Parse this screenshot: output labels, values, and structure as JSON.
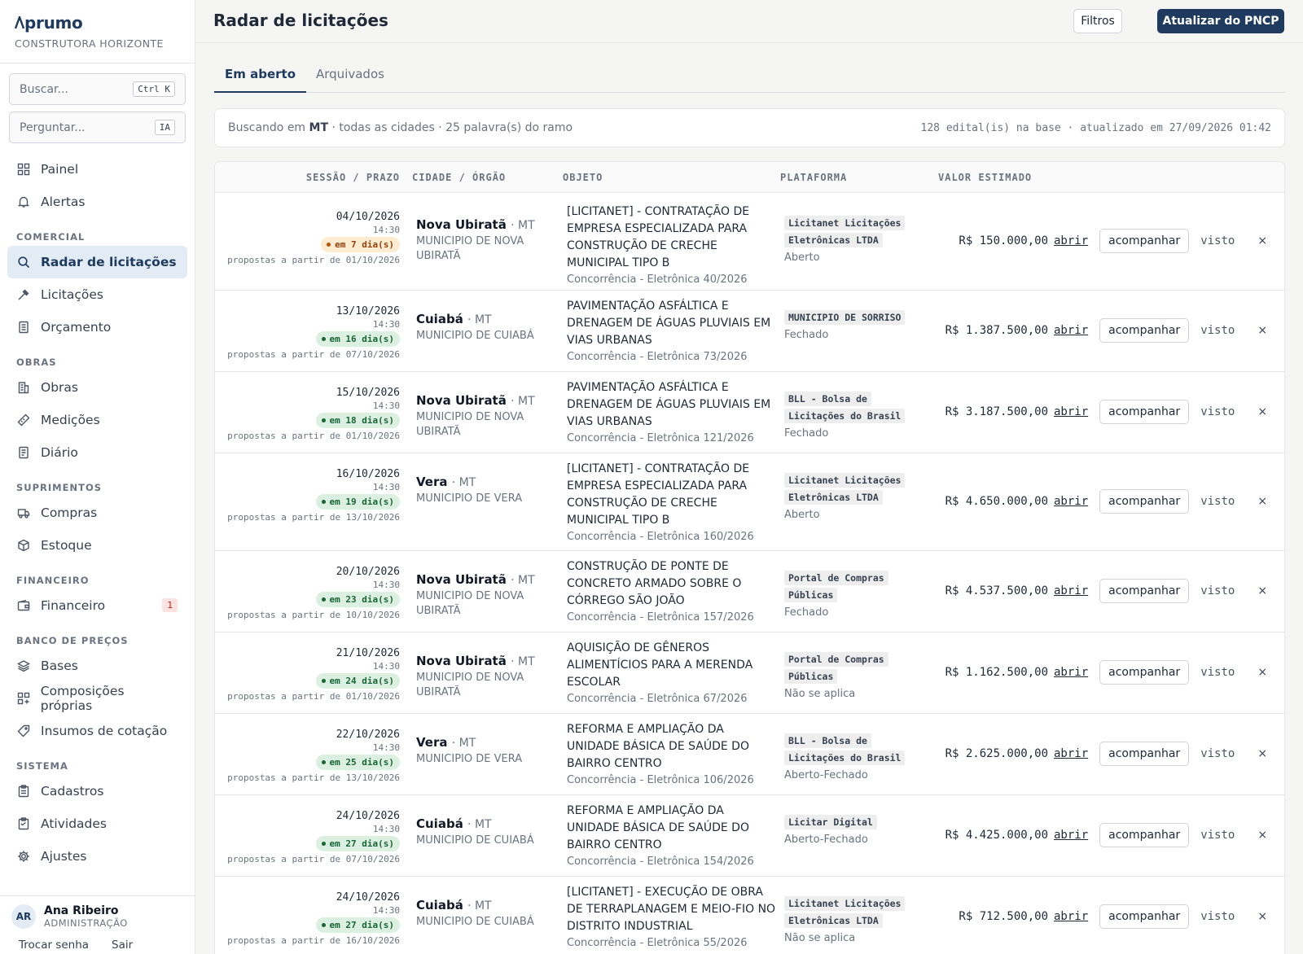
{
  "brand": {
    "logo": "prumo",
    "company": "CONSTRUTORA HORIZONTE"
  },
  "sidebar": {
    "search_placeholder": "Buscar...",
    "search_kbd": "Ctrl K",
    "ask_placeholder": "Perguntar...",
    "ask_kbd": "IA",
    "top": [
      {
        "label": "Painel",
        "icon": "grid-icon"
      },
      {
        "label": "Alertas",
        "icon": "bell-icon"
      }
    ],
    "sections": [
      {
        "title": "COMERCIAL",
        "items": [
          {
            "label": "Radar de licitações",
            "icon": "search-icon",
            "active": true
          },
          {
            "label": "Licitações",
            "icon": "gavel-icon"
          },
          {
            "label": "Orçamento",
            "icon": "document-icon"
          }
        ]
      },
      {
        "title": "OBRAS",
        "items": [
          {
            "label": "Obras",
            "icon": "building-icon"
          },
          {
            "label": "Medições",
            "icon": "ruler-icon"
          },
          {
            "label": "Diário",
            "icon": "notebook-icon"
          }
        ]
      },
      {
        "title": "SUPRIMENTOS",
        "items": [
          {
            "label": "Compras",
            "icon": "truck-icon"
          },
          {
            "label": "Estoque",
            "icon": "box-icon"
          }
        ]
      },
      {
        "title": "FINANCEIRO",
        "items": [
          {
            "label": "Financeiro",
            "icon": "wallet-icon",
            "badge": "1"
          }
        ]
      },
      {
        "title": "BANCO DE PREÇOS",
        "items": [
          {
            "label": "Bases",
            "icon": "layers-icon"
          },
          {
            "label": "Composições próprias",
            "icon": "composition-icon"
          },
          {
            "label": "Insumos de cotação",
            "icon": "tag-icon"
          }
        ]
      },
      {
        "title": "SISTEMA",
        "items": [
          {
            "label": "Cadastros",
            "icon": "clipboard-icon"
          },
          {
            "label": "Atividades",
            "icon": "checklist-icon"
          },
          {
            "label": "Ajustes",
            "icon": "gear-icon"
          }
        ]
      }
    ],
    "user": {
      "initials": "AR",
      "name": "Ana Ribeiro",
      "role": "ADMINISTRAÇÃO",
      "change_password": "Trocar senha",
      "logout": "Sair"
    }
  },
  "header": {
    "title": "Radar de licitações",
    "filters": "Filtros",
    "update": "Atualizar do PNCP"
  },
  "tabs": {
    "open": "Em aberto",
    "archived": "Arquivados"
  },
  "info": {
    "prefix": "Buscando em ",
    "state": "MT",
    "suffix": " · todas as cidades · 25 palavra(s) do ramo",
    "meta": "128 edital(is) na base · atualizado em 27/09/2026 01:42"
  },
  "table": {
    "headers": {
      "session": "SESSÃO / PRAZO",
      "city": "CIDADE / ÓRGÃO",
      "object": "OBJETO",
      "platform": "PLATAFORMA",
      "value": "VALOR ESTIMADO"
    },
    "actions": {
      "open": "abrir",
      "follow": "acompanhar",
      "seen": "visto",
      "dismiss": "×"
    },
    "rows": [
      {
        "date": "04/10/2026",
        "time": "14:30",
        "days": "em 7 dia(s)",
        "tone": "warn",
        "proposals": "propostas a partir de 01/10/2026",
        "city": "Nova Ubiratã",
        "uf": "· MT",
        "org": "MUNICIPIO DE NOVA UBIRATÃ",
        "object": "[LICITANET] - CONTRATAÇÃO DE EMPRESA ESPECIALIZADA PARA CONSTRUÇÃO DE CRECHE MUNICIPAL TIPO B",
        "modality": "Concorrência - Eletrônica 40/2026",
        "platform": "Licitanet Licitações Eletrônicas LTDA",
        "status": "Aberto",
        "value": "R$ 150.000,00"
      },
      {
        "date": "13/10/2026",
        "time": "14:30",
        "days": "em 16 dia(s)",
        "tone": "ok",
        "proposals": "propostas a partir de 07/10/2026",
        "city": "Cuiabá",
        "uf": "· MT",
        "org": "MUNICIPIO DE CUIABÁ",
        "object": "PAVIMENTAÇÃO ASFÁLTICA E DRENAGEM DE ÁGUAS PLUVIAIS EM VIAS URBANAS",
        "modality": "Concorrência - Eletrônica 73/2026",
        "platform": "MUNICIPIO DE SORRISO",
        "status": "Fechado",
        "value": "R$ 1.387.500,00"
      },
      {
        "date": "15/10/2026",
        "time": "14:30",
        "days": "em 18 dia(s)",
        "tone": "ok",
        "proposals": "propostas a partir de 01/10/2026",
        "city": "Nova Ubiratã",
        "uf": "· MT",
        "org": "MUNICIPIO DE NOVA UBIRATÃ",
        "object": "PAVIMENTAÇÃO ASFÁLTICA E DRENAGEM DE ÁGUAS PLUVIAIS EM VIAS URBANAS",
        "modality": "Concorrência - Eletrônica 121/2026",
        "platform": "BLL - Bolsa de Licitações do Brasil",
        "status": "Fechado",
        "value": "R$ 3.187.500,00"
      },
      {
        "date": "16/10/2026",
        "time": "14:30",
        "days": "em 19 dia(s)",
        "tone": "ok",
        "proposals": "propostas a partir de 13/10/2026",
        "city": "Vera",
        "uf": "· MT",
        "org": "MUNICIPIO DE VERA",
        "object": "[LICITANET] - CONTRATAÇÃO DE EMPRESA ESPECIALIZADA PARA CONSTRUÇÃO DE CRECHE MUNICIPAL TIPO B",
        "modality": "Concorrência - Eletrônica 160/2026",
        "platform": "Licitanet Licitações Eletrônicas LTDA",
        "status": "Aberto",
        "value": "R$ 4.650.000,00"
      },
      {
        "date": "20/10/2026",
        "time": "14:30",
        "days": "em 23 dia(s)",
        "tone": "ok",
        "proposals": "propostas a partir de 10/10/2026",
        "city": "Nova Ubiratã",
        "uf": "· MT",
        "org": "MUNICIPIO DE NOVA UBIRATÃ",
        "object": "CONSTRUÇÃO DE PONTE DE CONCRETO ARMADO SOBRE O CÓRREGO SÃO JOÃO",
        "modality": "Concorrência - Eletrônica 157/2026",
        "platform": "Portal de Compras Públicas",
        "status": "Fechado",
        "value": "R$ 4.537.500,00"
      },
      {
        "date": "21/10/2026",
        "time": "14:30",
        "days": "em 24 dia(s)",
        "tone": "ok",
        "proposals": "propostas a partir de 01/10/2026",
        "city": "Nova Ubiratã",
        "uf": "· MT",
        "org": "MUNICIPIO DE NOVA UBIRATÃ",
        "object": "AQUISIÇÃO DE GÊNEROS ALIMENTÍCIOS PARA A MERENDA ESCOLAR",
        "modality": "Concorrência - Eletrônica 67/2026",
        "platform": "Portal de Compras Públicas",
        "status": "Não se aplica",
        "value": "R$ 1.162.500,00"
      },
      {
        "date": "22/10/2026",
        "time": "14:30",
        "days": "em 25 dia(s)",
        "tone": "ok",
        "proposals": "propostas a partir de 13/10/2026",
        "city": "Vera",
        "uf": "· MT",
        "org": "MUNICIPIO DE VERA",
        "object": "REFORMA E AMPLIAÇÃO DA UNIDADE BÁSICA DE SAÚDE DO BAIRRO CENTRO",
        "modality": "Concorrência - Eletrônica 106/2026",
        "platform": "BLL - Bolsa de Licitações do Brasil",
        "status": "Aberto-Fechado",
        "value": "R$ 2.625.000,00"
      },
      {
        "date": "24/10/2026",
        "time": "14:30",
        "days": "em 27 dia(s)",
        "tone": "ok",
        "proposals": "propostas a partir de 07/10/2026",
        "city": "Cuiabá",
        "uf": "· MT",
        "org": "MUNICIPIO DE CUIABÁ",
        "object": "REFORMA E AMPLIAÇÃO DA UNIDADE BÁSICA DE SAÚDE DO BAIRRO CENTRO",
        "modality": "Concorrência - Eletrônica 154/2026",
        "platform": "Licitar Digital",
        "status": "Aberto-Fechado",
        "value": "R$ 4.425.000,00"
      },
      {
        "date": "24/10/2026",
        "time": "14:30",
        "days": "em 27 dia(s)",
        "tone": "ok",
        "proposals": "propostas a partir de 16/10/2026",
        "city": "Cuiabá",
        "uf": "· MT",
        "org": "MUNICIPIO DE CUIABÁ",
        "object": "[LICITANET] - EXECUÇÃO DE OBRA DE TERRAPLANAGEM E MEIO-FIO NO DISTRITO INDUSTRIAL",
        "modality": "Concorrência - Eletrônica 55/2026",
        "platform": "Licitanet Licitações Eletrônicas LTDA",
        "status": "Não se aplica",
        "value": "R$ 712.500,00"
      }
    ]
  }
}
